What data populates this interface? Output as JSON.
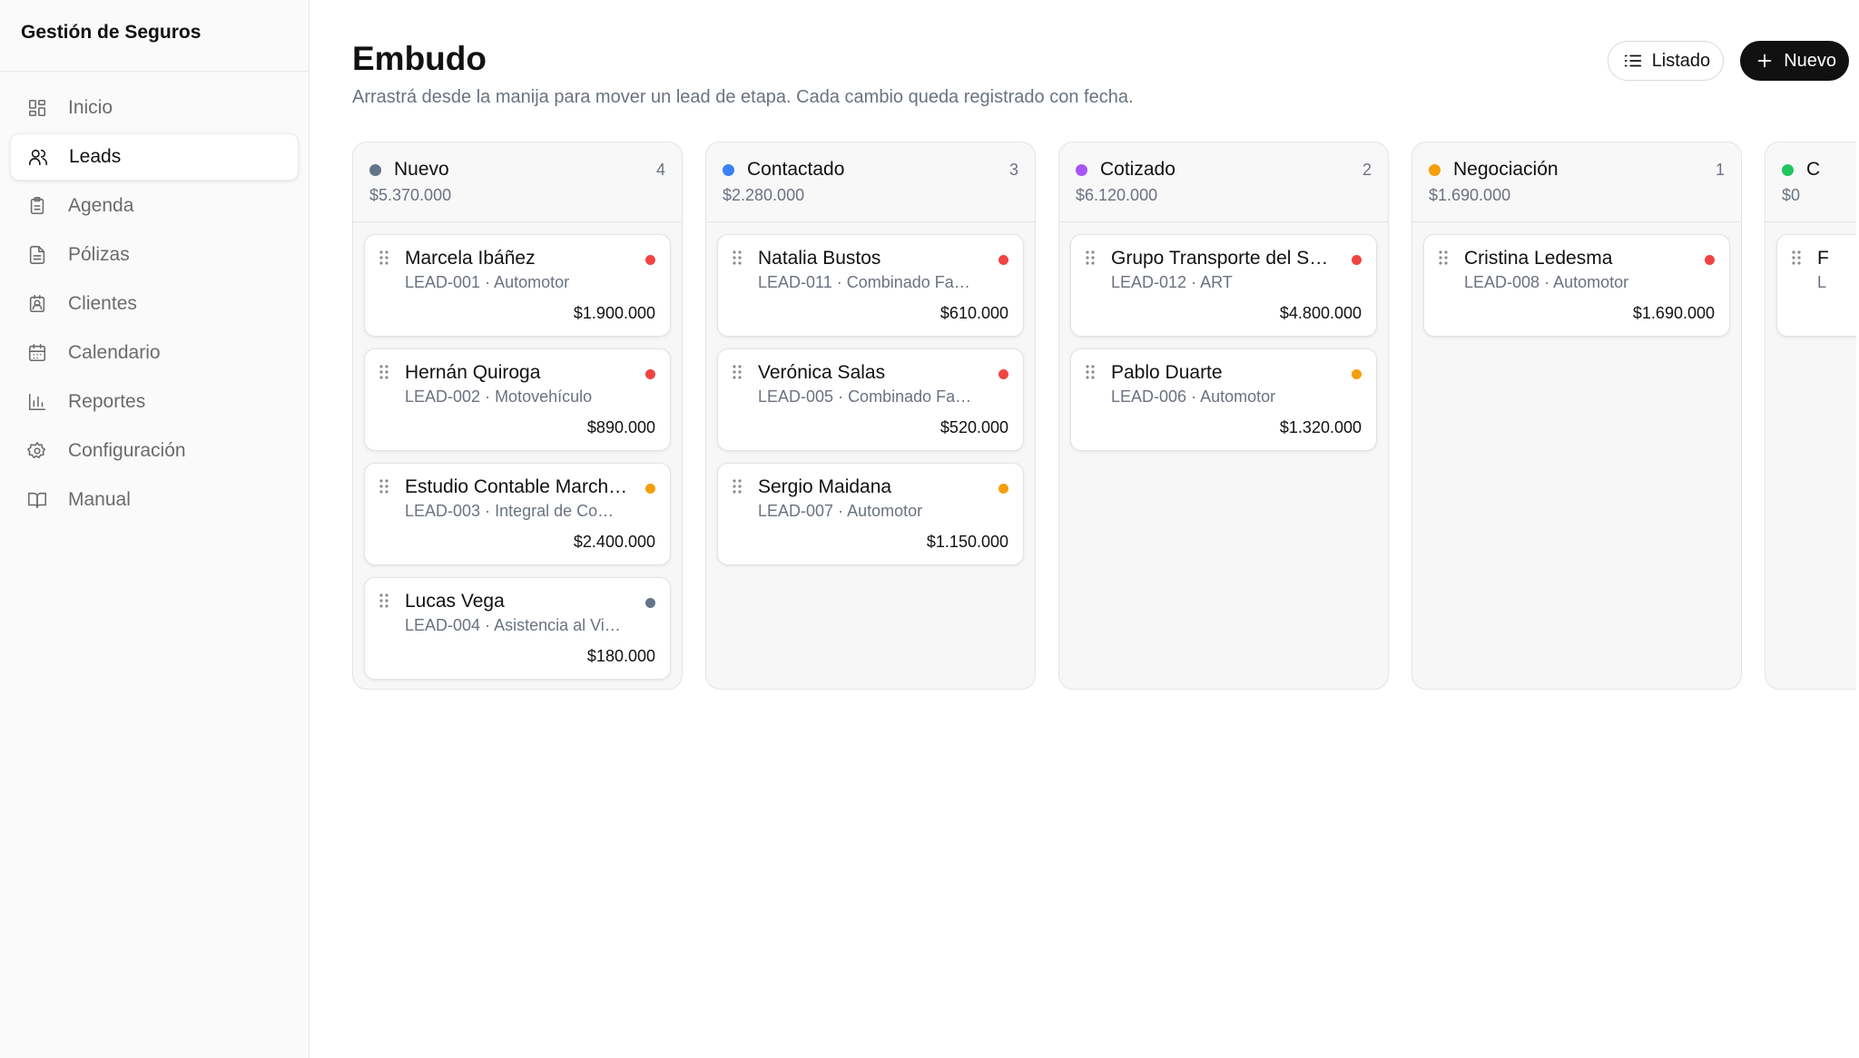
{
  "sidebar": {
    "brand": "Gestión de Seguros",
    "items": [
      {
        "label": "Inicio",
        "icon": "grid-icon",
        "active": false
      },
      {
        "label": "Leads",
        "icon": "users-icon",
        "active": true
      },
      {
        "label": "Agenda",
        "icon": "clipboard-icon",
        "active": false
      },
      {
        "label": "Pólizas",
        "icon": "document-icon",
        "active": false
      },
      {
        "label": "Clientes",
        "icon": "contact-icon",
        "active": false
      },
      {
        "label": "Calendario",
        "icon": "calendar-icon",
        "active": false
      },
      {
        "label": "Reportes",
        "icon": "bar-chart-icon",
        "active": false
      },
      {
        "label": "Configuración",
        "icon": "gear-icon",
        "active": false
      },
      {
        "label": "Manual",
        "icon": "book-icon",
        "active": false
      }
    ]
  },
  "header": {
    "title": "Embudo",
    "subtitle": "Arrastrá desde la manija para mover un lead de etapa. Cada cambio queda registrado con fecha.",
    "list_button": "Listado",
    "new_button": "Nuevo"
  },
  "colors": {
    "nuevo": "#64748b",
    "contactado": "#3b82f6",
    "cotizado": "#a855f7",
    "negociacion": "#f59e0b",
    "ganado": "#22c55e",
    "priority_high": "#ef4444",
    "priority_medium": "#f59e0b",
    "priority_low": "#64748b"
  },
  "columns": [
    {
      "name": "Nuevo",
      "count": "4",
      "total": "$5.370.000",
      "color": "#64748b",
      "cards": [
        {
          "name": "Marcela Ibáñez",
          "code": "LEAD-001",
          "product": "Automotor",
          "amount": "$1.900.000",
          "priority": "#ef4444"
        },
        {
          "name": "Hernán Quiroga",
          "code": "LEAD-002",
          "product": "Motovehículo",
          "amount": "$890.000",
          "priority": "#ef4444"
        },
        {
          "name": "Estudio Contable Marchetti",
          "code": "LEAD-003",
          "product": "Integral de Co…",
          "amount": "$2.400.000",
          "priority": "#f59e0b"
        },
        {
          "name": "Lucas Vega",
          "code": "LEAD-004",
          "product": "Asistencia al Vi…",
          "amount": "$180.000",
          "priority": "#64748b"
        }
      ]
    },
    {
      "name": "Contactado",
      "count": "3",
      "total": "$2.280.000",
      "color": "#3b82f6",
      "cards": [
        {
          "name": "Natalia Bustos",
          "code": "LEAD-011",
          "product": "Combinado Fa…",
          "amount": "$610.000",
          "priority": "#ef4444"
        },
        {
          "name": "Verónica Salas",
          "code": "LEAD-005",
          "product": "Combinado Fa…",
          "amount": "$520.000",
          "priority": "#ef4444"
        },
        {
          "name": "Sergio Maidana",
          "code": "LEAD-007",
          "product": "Automotor",
          "amount": "$1.150.000",
          "priority": "#f59e0b"
        }
      ]
    },
    {
      "name": "Cotizado",
      "count": "2",
      "total": "$6.120.000",
      "color": "#a855f7",
      "cards": [
        {
          "name": "Grupo Transporte del Su…",
          "code": "LEAD-012",
          "product": "ART",
          "amount": "$4.800.000",
          "priority": "#ef4444"
        },
        {
          "name": "Pablo Duarte",
          "code": "LEAD-006",
          "product": "Automotor",
          "amount": "$1.320.000",
          "priority": "#f59e0b"
        }
      ]
    },
    {
      "name": "Negociación",
      "count": "1",
      "total": "$1.690.000",
      "color": "#f59e0b",
      "cards": [
        {
          "name": "Cristina Ledesma",
          "code": "LEAD-008",
          "product": "Automotor",
          "amount": "$1.690.000",
          "priority": "#ef4444"
        }
      ]
    },
    {
      "name": "C",
      "count": "",
      "total": "$0",
      "color": "#22c55e",
      "cards": [
        {
          "name": "F",
          "code": "L",
          "product": "",
          "amount": "",
          "priority": ""
        }
      ]
    }
  ]
}
